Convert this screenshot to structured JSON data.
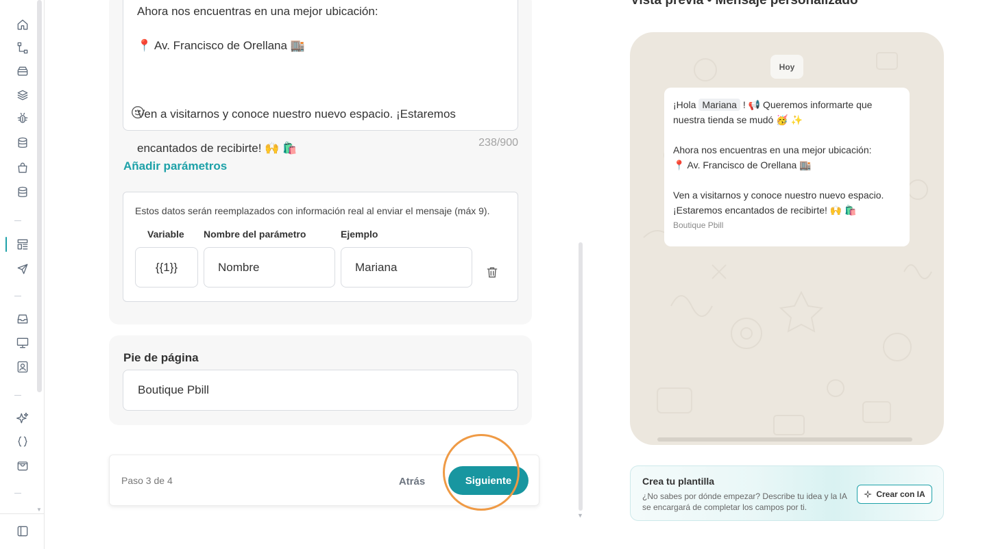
{
  "editor": {
    "message_lines": {
      "line0": "Ahora nos encuentras en una mejor ubicación:",
      "line1": "📍 Av. Francisco de Orellana 🏬",
      "line3": "Ven a visitarnos y conoce nuestro nuevo espacio. ¡Estaremos",
      "line4": "encantados de recibirte! 🙌 🛍️"
    },
    "char_counter": "238/900",
    "add_params_label": "Añadir parámetros"
  },
  "params": {
    "description": "Estos datos serán reemplazados con información real al enviar el mensaje (máx 9).",
    "headers": {
      "variable": "Variable",
      "name": "Nombre del parámetro",
      "example": "Ejemplo"
    },
    "row": {
      "variable": "{{1}}",
      "name": "Nombre",
      "example": "Mariana"
    }
  },
  "footer": {
    "label": "Pie de página",
    "value": "Boutique Pbill"
  },
  "stepper": {
    "step_text": "Paso 3 de 4",
    "back_label": "Atrás",
    "next_label": "Siguiente"
  },
  "preview": {
    "title": "Vista previa • Mensaje personalizado",
    "day_chip": "Hoy",
    "bubble": {
      "greeting_pre": "¡Hola",
      "name_chip": "Mariana",
      "greeting_post": "! 📢 Queremos informarte que",
      "line2": "nuestra tienda se mudó 🥳 ✨",
      "line4": "Ahora nos encuentras en una mejor ubicación:",
      "line5": "📍 Av. Francisco de Orellana 🏬",
      "line7": "Ven a visitarnos y conoce nuestro nuevo espacio.",
      "line8": "¡Estaremos encantados de recibirte! 🙌 🛍️",
      "footer": "Boutique Pbill"
    }
  },
  "ai_card": {
    "title": "Crea tu plantilla",
    "description": "¿No sabes por dónde empezar? Describe tu idea y la IA se encargará de completar los campos por ti.",
    "button_label": "Crear con IA"
  },
  "colors": {
    "accent": "#1da1a8",
    "primary_button": "#1896a0",
    "highlight_ring": "#ef9a45",
    "preview_bg": "#ece7de"
  }
}
